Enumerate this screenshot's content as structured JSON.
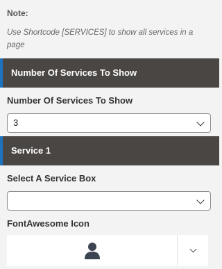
{
  "note": {
    "title": "Note:",
    "text": "Use Shortcode [SERVICES] to show all services in a page"
  },
  "sections": {
    "services_count_header": "Number Of Services To Show",
    "service_header": "Service 1"
  },
  "fields": {
    "services_count_label": "Number Of Services To Show",
    "services_count_value": "3",
    "service_box_label": "Select A Service Box",
    "service_box_value": "",
    "icon_label": "FontAwesome Icon",
    "icon_value": "user-icon"
  },
  "colors": {
    "header_bg": "#4a4643",
    "header_accent": "#1e73be",
    "icon_color": "#3d4451"
  }
}
